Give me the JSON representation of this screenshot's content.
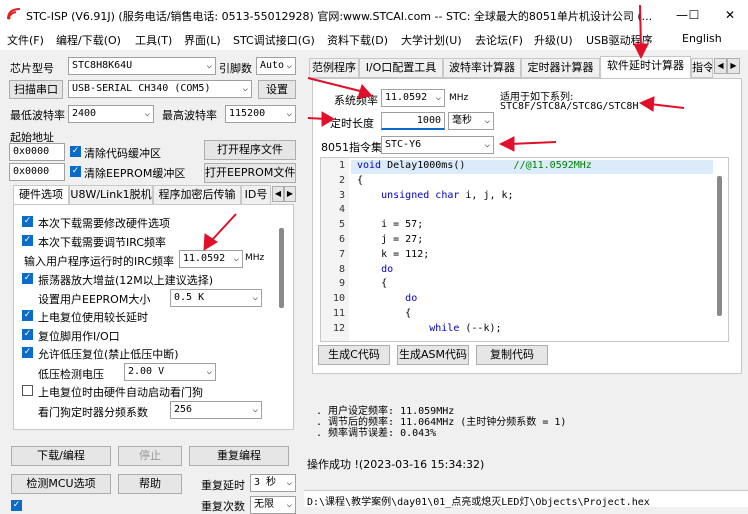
{
  "window": {
    "title": "STC-ISP (V6.91J) (服务电话/销售电话: 0513-55012928) 官网:www.STCAI.com  -- STC: 全球最大的8051单片机设计公司 (...",
    "minimize": "—",
    "maximize": "☐",
    "close": "✕"
  },
  "menu": [
    "文件(F)",
    "编程/下载(O)",
    "工具(T)",
    "界面(L)",
    "STC调试接口(G)",
    "资料下载(D)",
    "大学计划(U)",
    "去论坛(F)",
    "升级(U)",
    "USB驱动程序",
    "English"
  ],
  "left": {
    "chip_label": "芯片型号",
    "chip_value": "STC8H8K64U",
    "pin_label": "引脚数",
    "pin_value": "Auto",
    "scan_label": "扫描串口",
    "port_value": "USB-SERIAL CH340 (COM5)",
    "settings_btn": "设置",
    "min_baud_label": "最低波特率",
    "min_baud_value": "2400",
    "max_baud_label": "最高波特率",
    "max_baud_value": "115200",
    "start_addr_label": "起始地址",
    "addr1": "0x0000",
    "clear_code": "清除代码缓冲区",
    "open_prog_btn": "打开程序文件",
    "addr2": "0x0000",
    "clear_eeprom": "清除EEPROM缓冲区",
    "open_eeprom_btn": "打开EEPROM文件",
    "tabs": [
      "硬件选项",
      "U8W/Link1脱机",
      "程序加密后传输",
      "ID号"
    ],
    "hw_options": {
      "opt1": "本次下载需要修改硬件选项",
      "opt2": "本次下载需要调节IRC频率",
      "freq_label": "输入用户程序运行时的IRC频率",
      "freq_value": "11.0592",
      "freq_unit": "MHz",
      "opt3": "振荡器放大增益(12M以上建议选择)",
      "eeprom_label": "设置用户EEPROM大小",
      "eeprom_value": "0.5 K",
      "opt4": "上电复位使用较长延时",
      "opt5": "复位脚用作I/O口",
      "opt6": "允许低压复位(禁止低压中断)",
      "lv_label": "低压检测电压",
      "lv_value": "2.00 V",
      "opt7": "上电复位时由硬件自动启动看门狗",
      "wdt_label": "看门狗定时器分频系数",
      "wdt_value": "256"
    },
    "download_btn": "下载/编程",
    "stop_btn": "停止",
    "reprog_btn": "重复编程",
    "check_mcu_btn": "检测MCU选项",
    "help_btn": "帮助",
    "repeat_delay_label": "重复延时",
    "repeat_delay_value": "3 秒",
    "repeat_count_label": "重复次数",
    "repeat_count_value": "无限"
  },
  "right": {
    "tabs": [
      "范例程序",
      "I/O口配置工具",
      "波特率计算器",
      "定时器计算器",
      "软件延时计算器",
      "指令"
    ],
    "sys_freq_label": "系统频率",
    "sys_freq_value": "11.0592",
    "sys_freq_unit": "MHz",
    "delay_label": "定时长度",
    "delay_value": "1000",
    "delay_unit": "毫秒",
    "isa_label": "8051指令集",
    "isa_value": "STC-Y6",
    "series_title": "适用于如下系列:",
    "series_value": "STC8F/STC8A/STC8G/STC8H",
    "code_lines": [
      {
        "n": "1",
        "t": "void Delay1000ms()        //@11.0592MHz"
      },
      {
        "n": "2",
        "t": "{"
      },
      {
        "n": "3",
        "t": "    unsigned char i, j, k;"
      },
      {
        "n": "4",
        "t": ""
      },
      {
        "n": "5",
        "t": "    i = 57;"
      },
      {
        "n": "6",
        "t": "    j = 27;"
      },
      {
        "n": "7",
        "t": "    k = 112;"
      },
      {
        "n": "8",
        "t": "    do"
      },
      {
        "n": "9",
        "t": "    {"
      },
      {
        "n": "10",
        "t": "        do"
      },
      {
        "n": "11",
        "t": "        {"
      },
      {
        "n": "12",
        "t": "            while (--k);"
      }
    ],
    "gen_c_btn": "生成C代码",
    "gen_asm_btn": "生成ASM代码",
    "copy_btn": "复制代码",
    "log_lines": [
      ". 用户设定频率: 11.059MHz",
      ". 调节后的频率: 11.064MHz (主时钟分频系数 = 1)",
      ". 频率调节误差: 0.043%"
    ],
    "status": "操作成功 !(2023-03-16 15:34:32)",
    "path": "D:\\课程\\教学案例\\day01\\01_点亮或熄灭LED灯\\Objects\\Project.hex"
  },
  "colors": {
    "annotation_arrow": "#e0102a",
    "checkbox": "#0a6bc8",
    "code_keyword": "#0000cc",
    "code_comment": "#008000"
  }
}
